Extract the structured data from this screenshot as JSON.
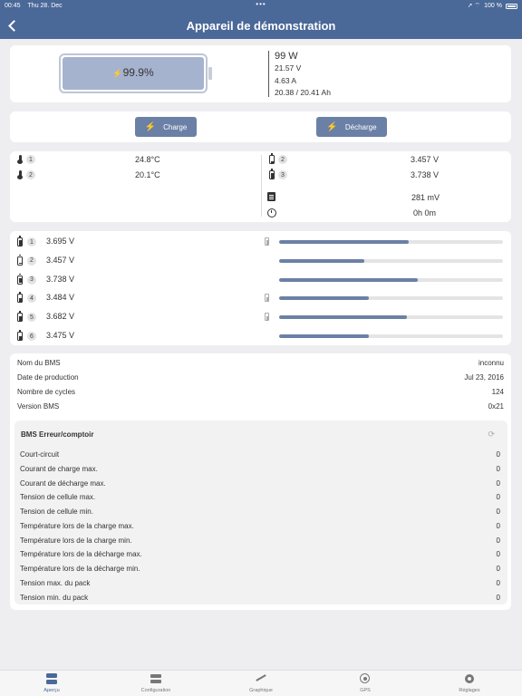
{
  "statusbar": {
    "time": "00:45",
    "date": "Thu 28. Dec",
    "dots": "•••",
    "signal": "➚ ⌔",
    "battery_pct": "100 %"
  },
  "nav": {
    "title": "Appareil de démonstration"
  },
  "battery": {
    "soc": 0.999,
    "soc_label": "99.9%",
    "power": "99 W",
    "voltage": "21.57 V",
    "current": "4.63 A",
    "capacity": "20.38 / 20.41 Ah"
  },
  "buttons": {
    "charge": "Charge",
    "discharge": "Décharge"
  },
  "temps": [
    {
      "index": "1",
      "value": "24.8°C"
    },
    {
      "index": "2",
      "value": "20.1°C"
    }
  ],
  "extremes": [
    {
      "index": "2",
      "value": "3.457 V"
    },
    {
      "index": "3",
      "value": "3.738 V"
    }
  ],
  "delta": "281 mV",
  "time_remaining": "0h 0m",
  "cells": [
    {
      "index": "1",
      "voltage": "3.695 V",
      "level": 0.58,
      "balancing": true,
      "icon": "full"
    },
    {
      "index": "2",
      "voltage": "3.457 V",
      "level": 0.38,
      "balancing": false,
      "icon": "low"
    },
    {
      "index": "3",
      "voltage": "3.738 V",
      "level": 0.62,
      "balancing": false,
      "icon": "full"
    },
    {
      "index": "4",
      "voltage": "3.484 V",
      "level": 0.4,
      "balancing": true,
      "icon": "mid"
    },
    {
      "index": "5",
      "voltage": "3.682 V",
      "level": 0.57,
      "balancing": true,
      "icon": "full"
    },
    {
      "index": "6",
      "voltage": "3.475 V",
      "level": 0.4,
      "balancing": false,
      "icon": "mid"
    }
  ],
  "info": [
    {
      "label": "Nom du BMS",
      "value": "inconnu"
    },
    {
      "label": "Date de production",
      "value": "Jul 23, 2016"
    },
    {
      "label": "Nombre de cycles",
      "value": "124"
    },
    {
      "label": "Version BMS",
      "value": "0x21"
    }
  ],
  "errors": {
    "title": "BMS Erreur/comptoir",
    "refresh_glyph": "⟳",
    "items": [
      {
        "label": "Court-circuit",
        "value": "0"
      },
      {
        "label": "Courant de charge max.",
        "value": "0"
      },
      {
        "label": "Courant de décharge max.",
        "value": "0"
      },
      {
        "label": "Tension de cellule max.",
        "value": "0"
      },
      {
        "label": "Tension de cellule min.",
        "value": "0"
      },
      {
        "label": "Température lors de la charge max.",
        "value": "0"
      },
      {
        "label": "Température lors de la charge min.",
        "value": "0"
      },
      {
        "label": "Température lors de la décharge max.",
        "value": "0"
      },
      {
        "label": "Température lors de la décharge min.",
        "value": "0"
      },
      {
        "label": "Tension max. du pack",
        "value": "0"
      },
      {
        "label": "Tension min. du pack",
        "value": "0"
      }
    ]
  },
  "tabs": [
    {
      "label": "Aperçu",
      "icon": "overview",
      "active": true
    },
    {
      "label": "Configuration",
      "icon": "config",
      "active": false
    },
    {
      "label": "Graphique",
      "icon": "graph",
      "active": false
    },
    {
      "label": "GPS",
      "icon": "gps",
      "active": false
    },
    {
      "label": "Réglages",
      "icon": "settings",
      "active": false
    }
  ]
}
